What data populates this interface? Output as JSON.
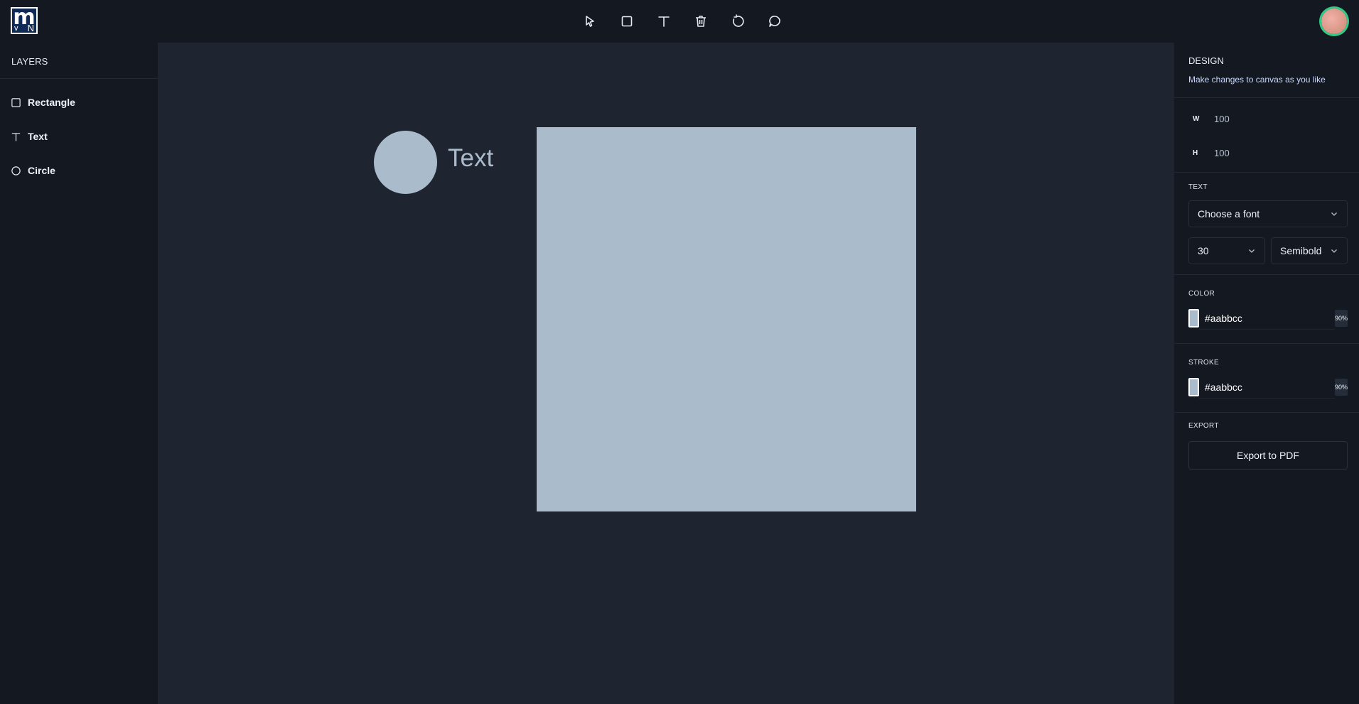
{
  "app": {
    "logo": {
      "main": "m",
      "sub_left": "v",
      "sub_right": "N"
    }
  },
  "toolbar": {
    "tools": [
      {
        "name": "select",
        "icon": "cursor-arrow-icon"
      },
      {
        "name": "rectangle",
        "icon": "square-icon"
      },
      {
        "name": "text",
        "icon": "text-t-icon"
      },
      {
        "name": "delete",
        "icon": "trash-icon"
      },
      {
        "name": "reset",
        "icon": "rotate-icon"
      },
      {
        "name": "comments",
        "icon": "comment-bubble-icon"
      }
    ]
  },
  "user": {
    "avatar": "avatar-image"
  },
  "layers": {
    "title": "LAYERS",
    "items": [
      {
        "label": "Rectangle",
        "icon": "square-icon"
      },
      {
        "label": "Text",
        "icon": "text-t-icon"
      },
      {
        "label": "Circle",
        "icon": "circle-icon"
      }
    ]
  },
  "canvas": {
    "text_object": "Text",
    "fill_color": "#aabbcc",
    "background": "#1f2530"
  },
  "design": {
    "title": "DESIGN",
    "subtitle": "Make changes to canvas as you like",
    "width_label": "W",
    "width_value": "100",
    "height_label": "H",
    "height_value": "100",
    "text_section": {
      "title": "TEXT",
      "font_select": "Choose a font",
      "size_select": "30",
      "weight_select": "Semibold"
    },
    "color_section": {
      "title": "COLOR",
      "hex": "#aabbcc",
      "opacity": "90%"
    },
    "stroke_section": {
      "title": "STROKE",
      "hex": "#aabbcc",
      "opacity": "90%"
    },
    "export_section": {
      "title": "EXPORT",
      "button": "Export to PDF"
    }
  },
  "colors": {
    "topbar": "#131821",
    "sidebar": "#131821",
    "canvas": "#1f2530",
    "shape_fill": "#aabbcc",
    "accent_ring": "#2ecc88"
  }
}
